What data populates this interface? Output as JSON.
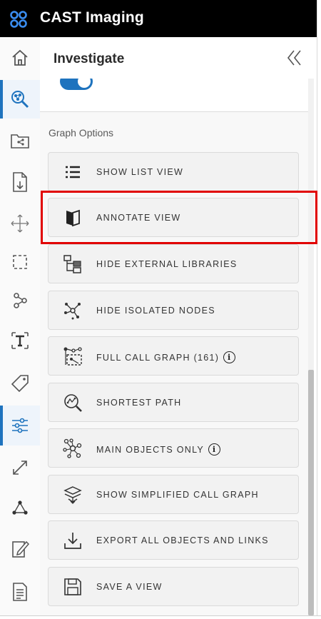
{
  "app": {
    "title": "CAST Imaging",
    "brand_color": "#1e73be"
  },
  "panel": {
    "title": "Investigate",
    "collapse_icon": "double-chevron-left-icon"
  },
  "rail": [
    {
      "name": "home-icon",
      "active": false
    },
    {
      "name": "investigate-icon",
      "active": true
    },
    {
      "name": "folder-share-icon",
      "active": false
    },
    {
      "name": "file-download-icon",
      "active": false
    },
    {
      "name": "move-arrows-icon",
      "active": false
    },
    {
      "name": "selection-box-icon",
      "active": false
    },
    {
      "name": "path-nodes-icon",
      "active": false
    },
    {
      "name": "text-tool-icon",
      "active": false
    },
    {
      "name": "tag-icon",
      "active": false
    },
    {
      "name": "sliders-icon",
      "active": true
    },
    {
      "name": "expand-arrows-icon",
      "active": false
    },
    {
      "name": "graph-triangle-icon",
      "active": false
    },
    {
      "name": "edit-note-icon",
      "active": false
    },
    {
      "name": "document-icon",
      "active": false
    }
  ],
  "graph_options": {
    "label": "Graph Options",
    "items": [
      {
        "label": "SHOW LIST VIEW",
        "icon": "list-icon",
        "info": false
      },
      {
        "label": "ANNOTATE VIEW",
        "icon": "open-book-icon",
        "info": false
      },
      {
        "label": "HIDE EXTERNAL LIBRARIES",
        "icon": "hierarchy-icon",
        "info": false
      },
      {
        "label": "HIDE ISOLATED NODES",
        "icon": "isolated-nodes-icon",
        "info": false
      },
      {
        "label": "FULL CALL GRAPH (161)",
        "icon": "call-graph-icon",
        "info": true
      },
      {
        "label": "SHORTEST PATH",
        "icon": "search-path-icon",
        "info": false
      },
      {
        "label": "MAIN OBJECTS ONLY",
        "icon": "main-objects-icon",
        "info": true
      },
      {
        "label": "SHOW SIMPLIFIED CALL GRAPH",
        "icon": "layers-icon",
        "info": false
      },
      {
        "label": "EXPORT ALL OBJECTS AND LINKS",
        "icon": "download-icon",
        "info": false
      },
      {
        "label": "SAVE A VIEW",
        "icon": "floppy-disk-icon",
        "info": false
      }
    ]
  },
  "info_glyph": "i"
}
